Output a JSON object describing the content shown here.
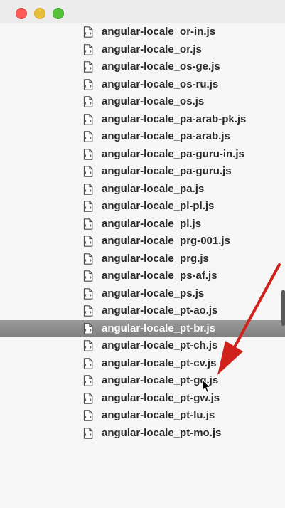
{
  "files": [
    "angular-locale_or-in.js",
    "angular-locale_or.js",
    "angular-locale_os-ge.js",
    "angular-locale_os-ru.js",
    "angular-locale_os.js",
    "angular-locale_pa-arab-pk.js",
    "angular-locale_pa-arab.js",
    "angular-locale_pa-guru-in.js",
    "angular-locale_pa-guru.js",
    "angular-locale_pa.js",
    "angular-locale_pl-pl.js",
    "angular-locale_pl.js",
    "angular-locale_prg-001.js",
    "angular-locale_prg.js",
    "angular-locale_ps-af.js",
    "angular-locale_ps.js",
    "angular-locale_pt-ao.js",
    "angular-locale_pt-br.js",
    "angular-locale_pt-ch.js",
    "angular-locale_pt-cv.js",
    "angular-locale_pt-gq.js",
    "angular-locale_pt-gw.js",
    "angular-locale_pt-lu.js",
    "angular-locale_pt-mo.js"
  ],
  "selected_index": 17,
  "icons": {
    "file": "document-icon",
    "close": "close-window-icon",
    "minimize": "minimize-window-icon",
    "zoom": "zoom-window-icon",
    "cursor": "mouse-cursor-icon",
    "annotation": "red-arrow-annotation"
  },
  "colors": {
    "selected_row": "#8c8c8c",
    "annotation_arrow": "#d0211c",
    "traffic_red": "#fc5b57",
    "traffic_yellow": "#e5bf3c",
    "traffic_green": "#57c038"
  }
}
